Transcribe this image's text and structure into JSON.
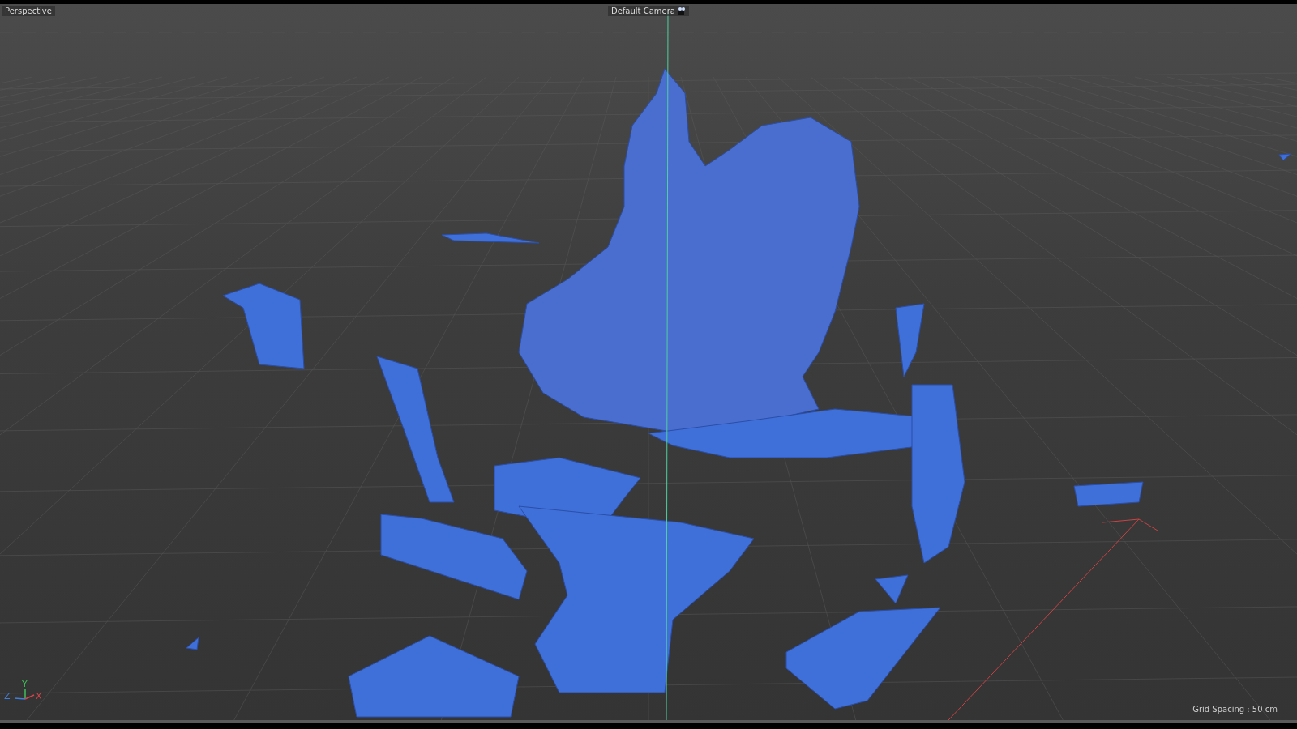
{
  "viewport": {
    "view_name": "Perspective",
    "camera": "Default Camera",
    "grid_spacing": "Grid Spacing : 50 cm",
    "axes": [
      "Y",
      "Z",
      "X"
    ]
  }
}
